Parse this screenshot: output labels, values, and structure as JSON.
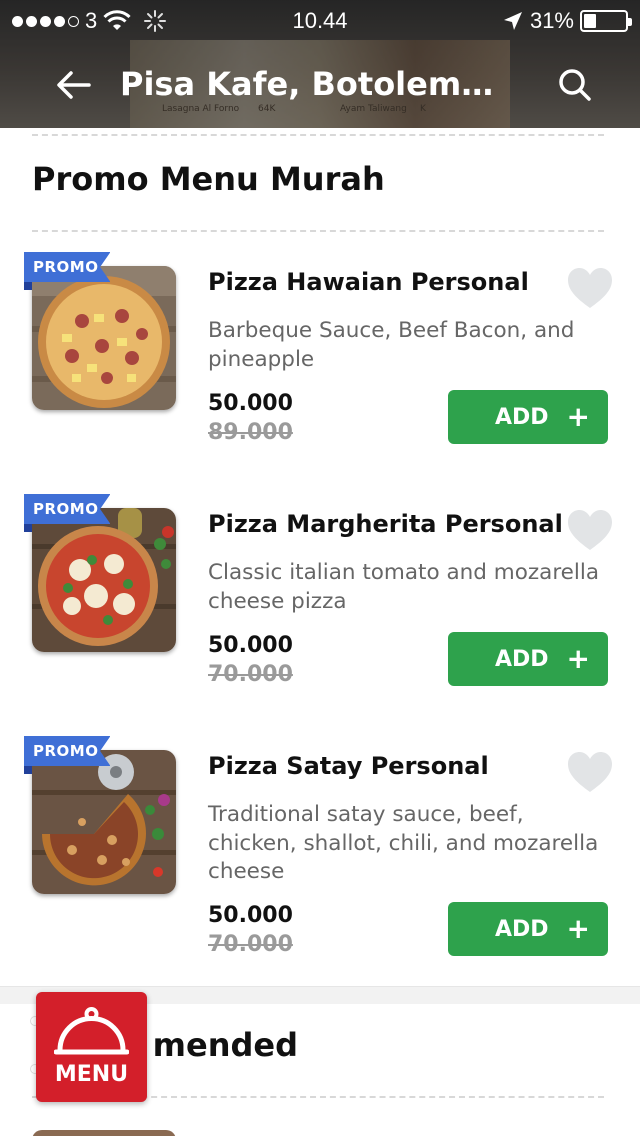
{
  "status_bar": {
    "carrier": "3",
    "time": "10.44",
    "battery": "31%",
    "battery_level": 0.31,
    "icons": [
      "signal-dots-icon",
      "wifi-icon",
      "activity-spinner-icon",
      "location-arrow-icon",
      "battery-icon"
    ]
  },
  "nav": {
    "title": "Pisa Kafe, Botolempangan",
    "back_icon": "arrow-left-icon",
    "search_icon": "search-icon"
  },
  "header_photo_captions": [
    "Lasagna Al Forno",
    "64K",
    "Ayam Taliwang",
    "K"
  ],
  "section": {
    "title": "Promo Menu Murah"
  },
  "items": [
    {
      "badge": "PROMO",
      "name": "Pizza Hawaian Personal",
      "description": "Barbeque Sauce, Beef Bacon, and pineapple",
      "price": "50.000",
      "old_price": "89.000",
      "add_label": "ADD",
      "add_icon": "+"
    },
    {
      "badge": "PROMO",
      "name": "Pizza Margherita Personal",
      "description": "Classic italian tomato and mozarella cheese pizza",
      "price": "50.000",
      "old_price": "70.000",
      "add_label": "ADD",
      "add_icon": "+"
    },
    {
      "badge": "PROMO",
      "name": "Pizza Satay Personal",
      "description": "Traditional satay sauce, beef, chicken, shallot, chili, and mozarella cheese",
      "price": "50.000",
      "old_price": "70.000",
      "add_label": "ADD",
      "add_icon": "+"
    }
  ],
  "next_section": {
    "title_visible": "mended"
  },
  "menu_fab": {
    "label": "MENU",
    "icon": "cloche-icon"
  },
  "colors": {
    "add_green": "#2ea24c",
    "promo_blue": "#3f6fd6",
    "menu_red": "#d31f2a"
  }
}
